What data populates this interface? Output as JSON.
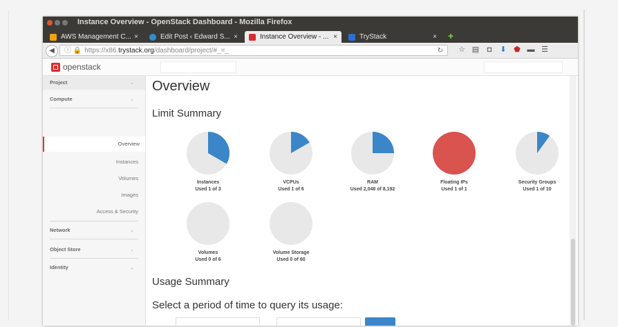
{
  "browser": {
    "window_title": "Instance Overview - OpenStack Dashboard - Mozilla Firefox",
    "tabs": [
      {
        "label": "AWS Management C...",
        "color": "#f0a30a"
      },
      {
        "label": "Edit Post ‹ Edward S...",
        "color": "#2d8fd0"
      },
      {
        "label": "Instance Overview - ...",
        "color": "#da2c30"
      },
      {
        "label": "TryStack",
        "color": "#2d6fd0"
      }
    ],
    "tab_close": "×",
    "url_prefix": "https://x86.",
    "url_domain": "trystack.org",
    "url_path": "/dashboard/project/#_=_"
  },
  "header": {
    "logo": "openstack"
  },
  "sidebar": {
    "sections": [
      "Project",
      "Compute",
      "Network",
      "Object Store",
      "Identity"
    ],
    "compute_items": [
      "Overview",
      "Instances",
      "Volumes",
      "Images",
      "Access & Security"
    ]
  },
  "main": {
    "title": "Overview",
    "limit_summary": "Limit Summary",
    "usage_summary": "Usage Summary",
    "query_prompt": "Select a period of time to query its usage:"
  },
  "colors": {
    "used": "#3a86c8",
    "empty": "#e8e8e8",
    "full": "#d9534f",
    "brand": "#da2c30"
  },
  "limits": [
    {
      "name": "Instances",
      "used_text": "Used 1 of 3",
      "used": 1,
      "total": 3
    },
    {
      "name": "VCPUs",
      "used_text": "Used 1 of 6",
      "used": 1,
      "total": 6
    },
    {
      "name": "RAM",
      "used_text": "Used 2,048 of 8,192",
      "used": 2048,
      "total": 8192
    },
    {
      "name": "Floating IPs",
      "used_text": "Used 1 of 1",
      "used": 1,
      "total": 1
    },
    {
      "name": "Security Groups",
      "used_text": "Used 1 of 10",
      "used": 1,
      "total": 10
    },
    {
      "name": "Volumes",
      "used_text": "Used 0 of 6",
      "used": 0,
      "total": 6
    },
    {
      "name": "Volume Storage",
      "used_text": "Used 0 of 60",
      "used": 0,
      "total": 60
    }
  ]
}
